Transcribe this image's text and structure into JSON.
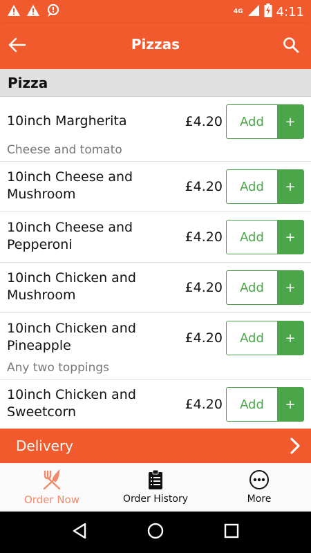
{
  "status_bar": {
    "network": "4G",
    "time": "4:11"
  },
  "app_bar": {
    "title": "Pizzas"
  },
  "section": {
    "title": "Pizza"
  },
  "items": [
    {
      "name": "10inch Margherita",
      "price": "£4.20",
      "description": "Cheese and tomato",
      "add_label": "Add",
      "plus_label": "+"
    },
    {
      "name": "10inch Cheese and Mushroom",
      "price": "£4.20",
      "add_label": "Add",
      "plus_label": "+"
    },
    {
      "name": "10inch Cheese and Pepperoni",
      "price": "£4.20",
      "add_label": "Add",
      "plus_label": "+"
    },
    {
      "name": "10inch Chicken and Mushroom",
      "price": "£4.20",
      "add_label": "Add",
      "plus_label": "+"
    },
    {
      "name": "10inch Chicken and Pineapple",
      "price": "£4.20",
      "description": "Any two toppings",
      "add_label": "Add",
      "plus_label": "+"
    },
    {
      "name": "10inch Chicken and Sweetcorn",
      "price": "£4.20",
      "add_label": "Add",
      "plus_label": "+"
    }
  ],
  "delivery_bar": {
    "label": "Delivery"
  },
  "bottom_nav": {
    "items": [
      {
        "label": "Order Now",
        "icon": "fork-knife-icon",
        "active": true
      },
      {
        "label": "Order History",
        "icon": "clipboard-icon",
        "active": false
      },
      {
        "label": "More",
        "icon": "more-dots-icon",
        "active": false
      }
    ]
  },
  "colors": {
    "primary": "#f05a2c",
    "accent_green": "#4aa648",
    "active_nav": "#f08a6c"
  }
}
